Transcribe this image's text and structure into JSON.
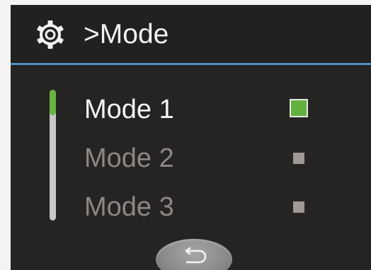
{
  "header": {
    "icon": "gear-icon",
    "title": ">Mode"
  },
  "modes": [
    {
      "label": "Mode 1",
      "selected": true
    },
    {
      "label": "Mode 2",
      "selected": false
    },
    {
      "label": "Mode 3",
      "selected": false
    }
  ],
  "footer": {
    "back_icon": "return-arrow-icon"
  },
  "colors": {
    "background": "#252423",
    "accent_line": "#4f8fc0",
    "selected": "#62b13c",
    "text_active": "#f4f4f4",
    "text_inactive": "#8d8785"
  }
}
